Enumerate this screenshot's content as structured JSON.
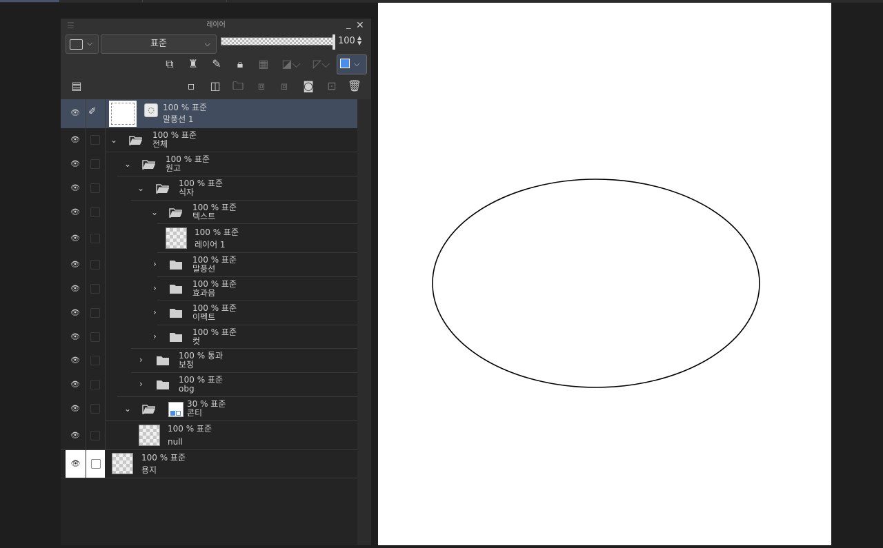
{
  "panel": {
    "title": "레이어",
    "blend_mode": "표준",
    "opacity": "100",
    "opacity_fraction": 1.0
  },
  "layers": [
    {
      "opacity_mode": "100 % 표준",
      "name": "말풍선 1",
      "kind": "balloon",
      "selected": true
    },
    {
      "opacity_mode": "100 % 표준",
      "name": "전체",
      "kind": "folder",
      "expanded": true
    },
    {
      "opacity_mode": "100 % 표준",
      "name": "원고",
      "kind": "folder",
      "expanded": true
    },
    {
      "opacity_mode": "100 % 표준",
      "name": "식자",
      "kind": "folder",
      "expanded": true
    },
    {
      "opacity_mode": "100 % 표준",
      "name": "텍스트",
      "kind": "folder",
      "expanded": true
    },
    {
      "opacity_mode": "100 % 표준",
      "name": "레이어 1",
      "kind": "raster"
    },
    {
      "opacity_mode": "100 % 표준",
      "name": "말풍선",
      "kind": "folder",
      "expanded": false
    },
    {
      "opacity_mode": "100 % 표준",
      "name": "효과음",
      "kind": "folder",
      "expanded": false
    },
    {
      "opacity_mode": "100 % 표준",
      "name": "이펙트",
      "kind": "folder",
      "expanded": false
    },
    {
      "opacity_mode": "100 % 표준",
      "name": "컷",
      "kind": "folder",
      "expanded": false
    },
    {
      "opacity_mode": "100 % 통과",
      "name": "보정",
      "kind": "folder",
      "expanded": false
    },
    {
      "opacity_mode": "100 % 표준",
      "name": "obg",
      "kind": "folder",
      "expanded": false
    },
    {
      "opacity_mode": "30 % 표준",
      "name": "콘티",
      "kind": "folder",
      "expanded": true
    },
    {
      "opacity_mode": "100 % 표준",
      "name": "null",
      "kind": "raster"
    },
    {
      "opacity_mode": "100 % 표준",
      "name": "용지",
      "kind": "paper"
    }
  ],
  "colors": {
    "selected_row": "#424c5f",
    "panel_bg": "#323232",
    "list_bg": "#242424",
    "accent": "#4b8de8"
  }
}
